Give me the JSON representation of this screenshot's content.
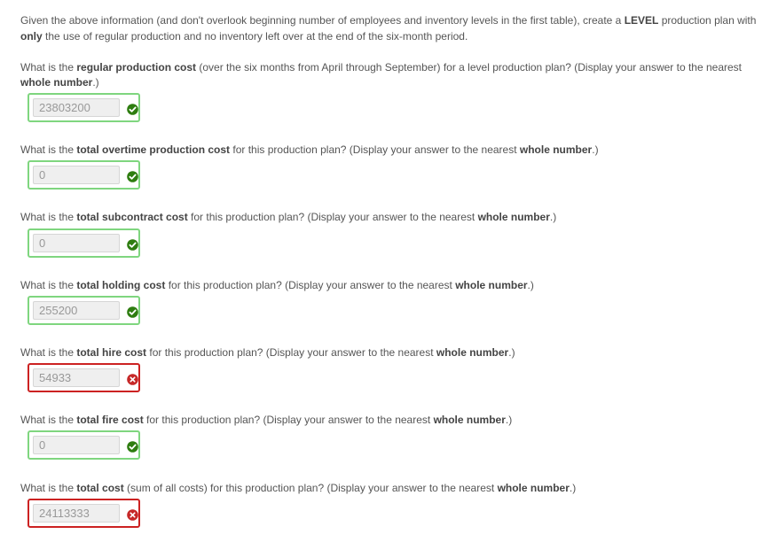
{
  "intro": {
    "p1": "Given the above information (and don't overlook beginning number of employees and inventory levels in the first table), create a ",
    "b1": "LEVEL",
    "p2": " production plan with ",
    "b2": "only",
    "p3": " the use of regular production and no inventory left over at the end of the six-month period."
  },
  "questions": [
    {
      "p1": "What is the ",
      "b1": "regular production cost",
      "p2": " (over the six months from April through September) for a level production plan? (Display your answer to the nearest ",
      "b2": "whole number",
      "p3": ".)",
      "value": "23803200",
      "status": "correct",
      "icon": "check-circle-icon"
    },
    {
      "p1": "What is the ",
      "b1": "total overtime production cost",
      "p2": " for this production plan? (Display your answer to the nearest ",
      "b2": "whole number",
      "p3": ".)",
      "value": "0",
      "status": "correct",
      "icon": "check-circle-icon"
    },
    {
      "p1": "What is the ",
      "b1": "total subcontract cost",
      "p2": " for this production plan? (Display your answer to the nearest ",
      "b2": "whole number",
      "p3": ".)",
      "value": "0",
      "status": "correct",
      "icon": "check-circle-icon"
    },
    {
      "p1": "What is the ",
      "b1": "total holding cost",
      "p2": " for this production plan? (Display your answer to the nearest ",
      "b2": "whole number",
      "p3": ".)",
      "value": "255200",
      "status": "correct",
      "icon": "check-circle-icon"
    },
    {
      "p1": "What is the ",
      "b1": "total hire cost",
      "p2": " for this production plan? (Display your answer to the nearest ",
      "b2": "whole number",
      "p3": ".)",
      "value": "54933",
      "status": "incorrect",
      "icon": "x-circle-icon"
    },
    {
      "p1": "What is the ",
      "b1": "total fire cost",
      "p2": " for this production plan? (Display your answer to the nearest ",
      "b2": "whole number",
      "p3": ".)",
      "value": "0",
      "status": "correct",
      "icon": "check-circle-icon"
    },
    {
      "p1": "What is the ",
      "b1": "total cost",
      "p2": " (sum of all costs) for this production plan? (Display your answer to the nearest ",
      "b2": "whole number",
      "p3": ".)",
      "value": "24113333",
      "status": "incorrect",
      "icon": "x-circle-icon"
    }
  ],
  "colors": {
    "correct_border": "#7fd67f",
    "incorrect_border": "#cc2222",
    "check_fill": "#2e7d10",
    "x_fill": "#c62828"
  }
}
